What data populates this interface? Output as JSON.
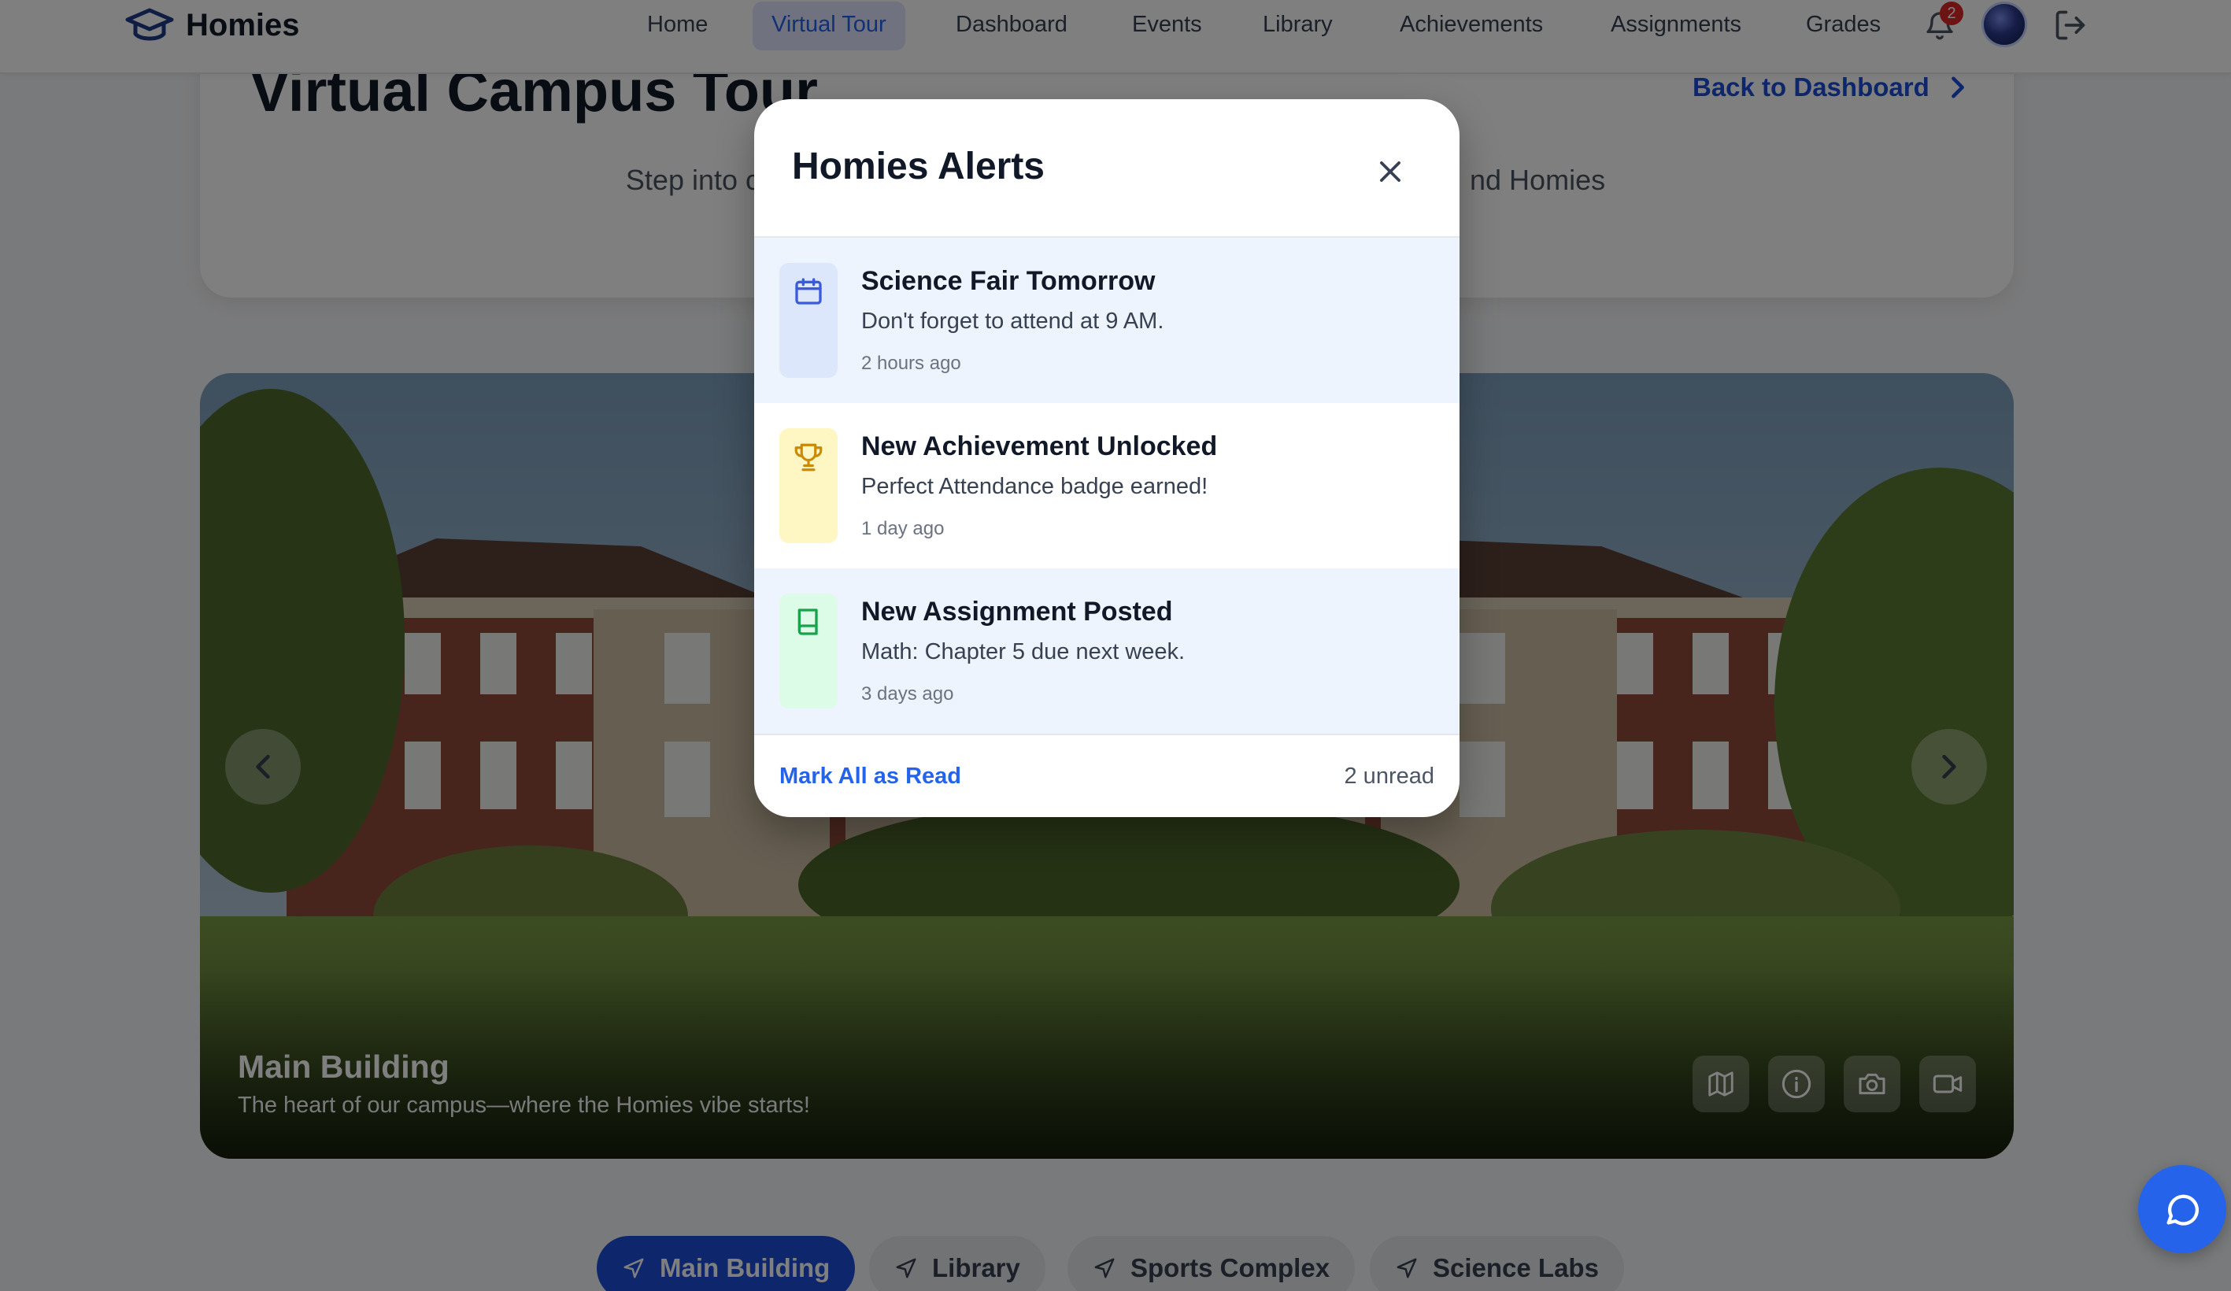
{
  "brand": {
    "name": "Homies",
    "logo_icon": "graduation-cap-icon"
  },
  "nav": {
    "links": [
      {
        "label": "Home",
        "active": false
      },
      {
        "label": "Virtual Tour",
        "active": true
      },
      {
        "label": "Dashboard",
        "active": false
      },
      {
        "label": "Events",
        "active": false
      },
      {
        "label": "Library",
        "active": false
      },
      {
        "label": "Achievements",
        "active": false
      },
      {
        "label": "Assignments",
        "active": false
      },
      {
        "label": "Grades",
        "active": false
      }
    ],
    "notification_count": "2",
    "icons": [
      "bell-icon",
      "avatar",
      "logout-icon"
    ]
  },
  "page": {
    "title": "Virtual Campus Tour",
    "back_link": "Back to Dashboard",
    "intro_left": "Step into c",
    "intro_right": "nd Homies"
  },
  "tour": {
    "location_title": "Main Building",
    "location_subtitle": "The heart of our campus—where the Homies vibe starts!",
    "tools": [
      "map-icon",
      "info-icon",
      "camera-icon",
      "video-icon"
    ],
    "tabs": [
      {
        "label": "Main Building",
        "active": true
      },
      {
        "label": "Library",
        "active": false
      },
      {
        "label": "Sports Complex",
        "active": false
      },
      {
        "label": "Science Labs",
        "active": false
      }
    ]
  },
  "modal": {
    "title": "Homies Alerts",
    "alerts": [
      {
        "title": "Science Fair Tomorrow",
        "message": "Don't forget to attend at 9 AM.",
        "time": "2 hours ago",
        "icon": "calendar-icon",
        "unread": true,
        "color": "#3b5bdb",
        "tint": "#dde7fb"
      },
      {
        "title": "New Achievement Unlocked",
        "message": "Perfect Attendance badge earned!",
        "time": "1 day ago",
        "icon": "trophy-icon",
        "unread": false,
        "color": "#ca8a04",
        "tint": "#fef6c3"
      },
      {
        "title": "New Assignment Posted",
        "message": "Math: Chapter 5 due next week.",
        "time": "3 days ago",
        "icon": "book-icon",
        "unread": true,
        "color": "#16a34a",
        "tint": "#dcfce7"
      }
    ],
    "mark_all": "Mark All as Read",
    "unread_text": "2 unread"
  },
  "colors": {
    "primary": "#2563eb",
    "danger": "#dc2626",
    "overlay": "rgba(0,0,0,0.5)"
  }
}
